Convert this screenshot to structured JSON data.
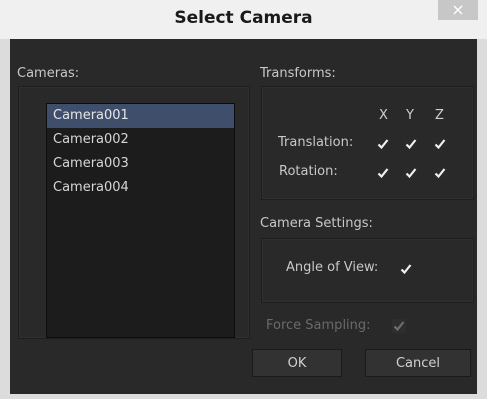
{
  "window": {
    "title": "Select Camera",
    "close_glyph": "×"
  },
  "cameras": {
    "label": "Cameras:",
    "items": [
      {
        "label": "Camera001",
        "selected": true
      },
      {
        "label": "Camera002",
        "selected": false
      },
      {
        "label": "Camera003",
        "selected": false
      },
      {
        "label": "Camera004",
        "selected": false
      }
    ]
  },
  "transforms": {
    "label": "Transforms:",
    "axes": [
      "X",
      "Y",
      "Z"
    ],
    "translation": {
      "label": "Translation:",
      "x": true,
      "y": true,
      "z": true
    },
    "rotation": {
      "label": "Rotation:",
      "x": true,
      "y": true,
      "z": true
    }
  },
  "camera_settings": {
    "label": "Camera Settings:",
    "angle_of_view": {
      "label": "Angle of View:",
      "checked": true
    }
  },
  "force_sampling": {
    "label": "Force Sampling:",
    "checked": true,
    "enabled": false
  },
  "buttons": {
    "ok": "OK",
    "cancel": "Cancel"
  },
  "colors": {
    "background": "#292929",
    "selection": "#3f4f6b",
    "text": "#c8c8c8",
    "disabled_text": "#6a6a6a"
  },
  "icons": {
    "check": "checkmark-icon",
    "close": "close-icon"
  }
}
